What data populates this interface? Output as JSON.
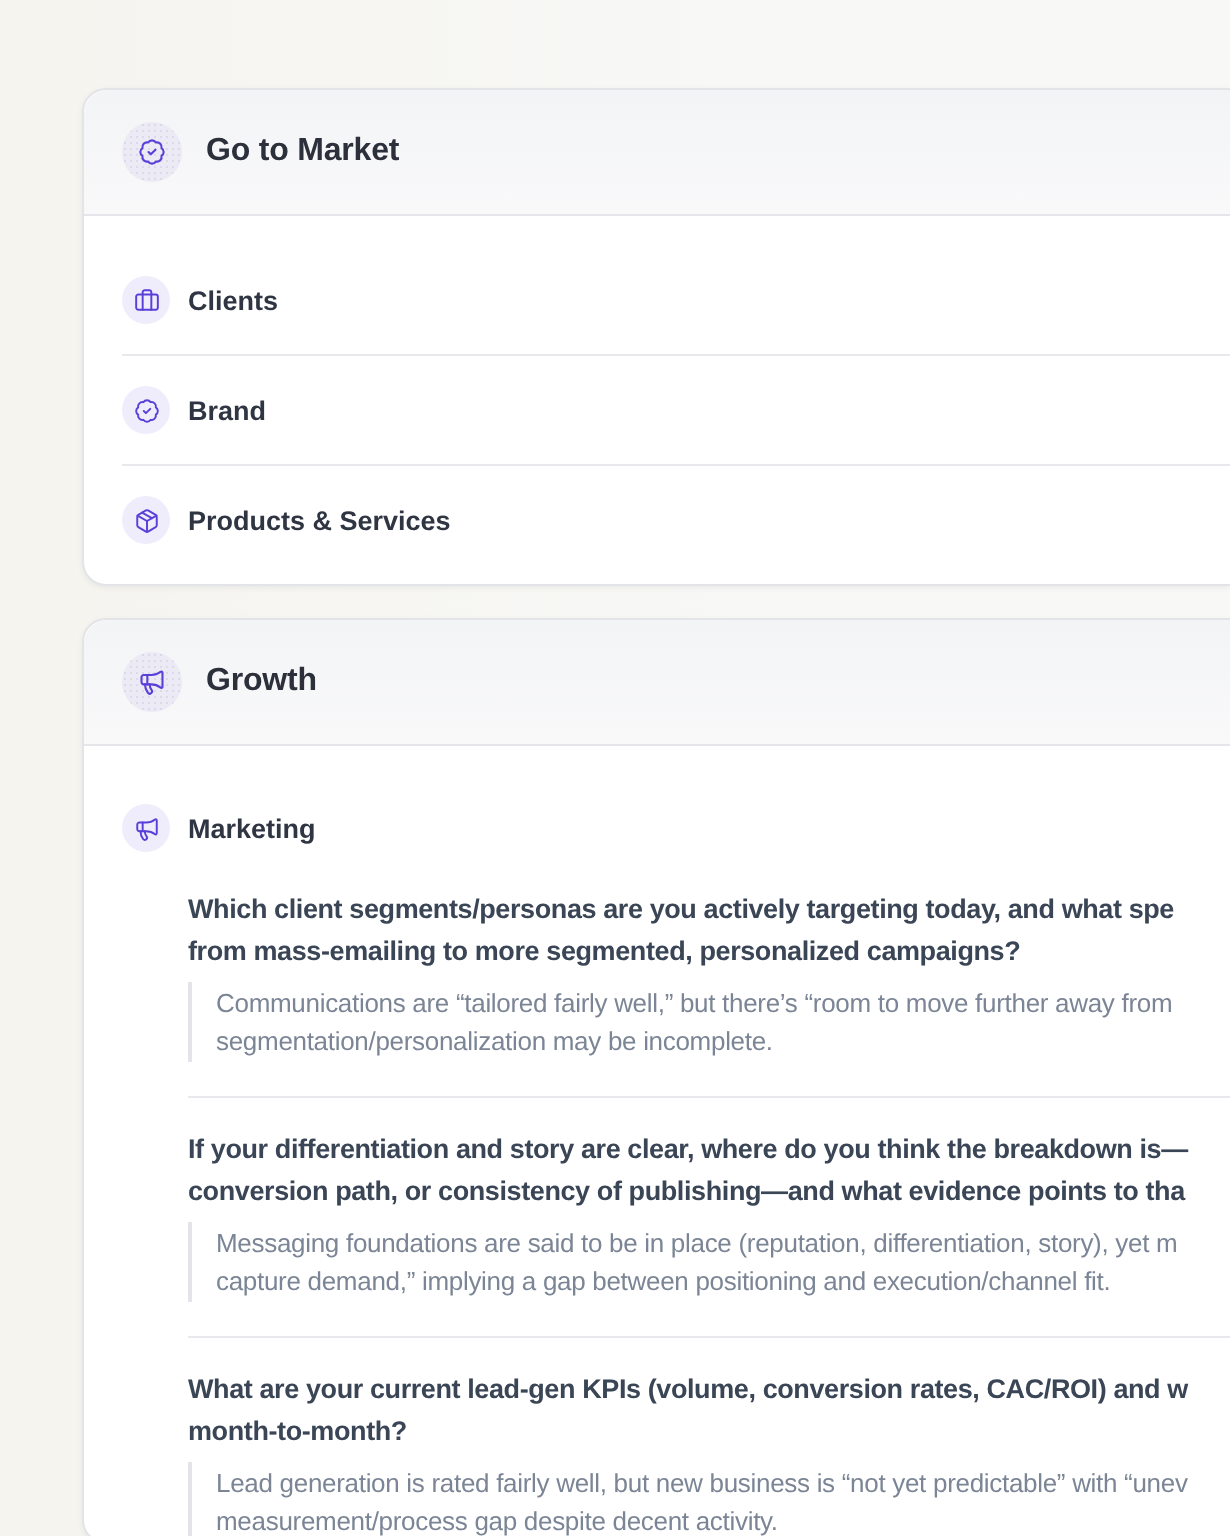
{
  "sections": [
    {
      "title": "Go to Market",
      "items": [
        {
          "label": "Clients"
        },
        {
          "label": "Brand"
        },
        {
          "label": "Products & Services"
        }
      ]
    },
    {
      "title": "Growth",
      "items": [
        {
          "label": "Marketing",
          "questions": [
            {
              "question_lines": [
                "Which client segments/personas are you actively targeting today, and what spe",
                "from mass-emailing to more segmented, personalized campaigns?"
              ],
              "answer_lines": [
                "Communications are “tailored fairly well,” but there’s “room to move further away from",
                "segmentation/personalization may be incomplete."
              ]
            },
            {
              "question_lines": [
                "If your differentiation and story are clear, where do you think the breakdown is—",
                "conversion path, or consistency of publishing—and what evidence points to tha"
              ],
              "answer_lines": [
                "Messaging foundations are said to be in place (reputation, differentiation, story), yet m",
                "capture demand,” implying a gap between positioning and execution/channel fit."
              ]
            },
            {
              "question_lines": [
                "What are your current lead-gen KPIs (volume, conversion rates, CAC/ROI) and w",
                "month-to-month?"
              ],
              "answer_lines": [
                "Lead generation is rated fairly well, but new business is “not yet predictable” with “unev",
                "measurement/process gap despite decent activity."
              ]
            }
          ]
        }
      ]
    }
  ]
}
